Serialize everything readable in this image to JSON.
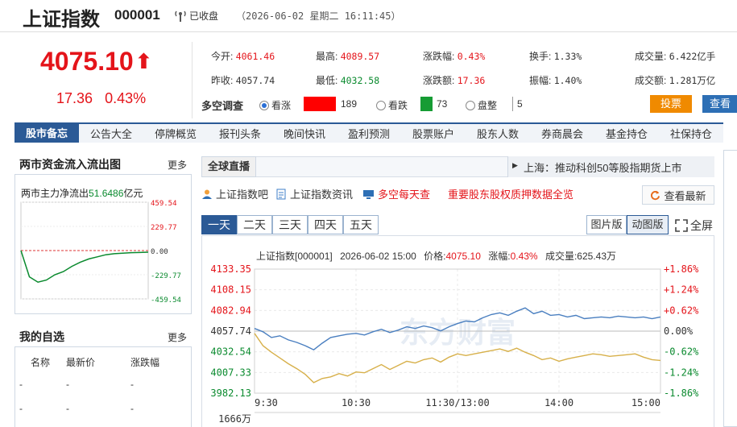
{
  "header": {
    "name": "上证指数",
    "code": "000001",
    "status": "已收盘",
    "time": "（2026-06-02 星期二 16:11:45）"
  },
  "quote": {
    "price": "4075.10",
    "arrow": "⬆",
    "change": "17.36",
    "change_pct": "0.43%"
  },
  "stats": {
    "open_label": "今开:",
    "open": "4061.46",
    "high_label": "最高:",
    "high": "4089.57",
    "pct_label": "涨跌幅:",
    "pct": "0.43%",
    "turnover_label": "换手:",
    "turnover": "1.33%",
    "vol_label": "成交量:",
    "vol": "6.422亿手",
    "prev_label": "昨收:",
    "prev": "4057.74",
    "low_label": "最低:",
    "low": "4032.58",
    "amt_label": "涨跌额:",
    "amt": "17.36",
    "amp_label": "振幅:",
    "amp": "1.40%",
    "value_label": "成交额:",
    "value": "1.281万亿"
  },
  "poll": {
    "title": "多空调查",
    "bull_label": "看涨",
    "bull_count": "189",
    "bear_label": "看跌",
    "bear_count": "73",
    "flat_label": "盘整",
    "flat_count": "5",
    "vote_button": "投票",
    "view_button": "查看",
    "colors": {
      "bull": "#ff0000",
      "bear": "#169c34"
    }
  },
  "nav": {
    "first": "股市备忘",
    "items": [
      "公告大全",
      "停牌概览",
      "报刊头条",
      "晚间快讯",
      "盈利预测",
      "股票账户",
      "股东人数",
      "券商晨会",
      "基金持仓",
      "社保持仓"
    ]
  },
  "flow_panel": {
    "title": "两市资金流入流出图",
    "more": "更多",
    "net_label": "两市主力净流出",
    "net_value": "51.6486",
    "net_unit": "亿元",
    "ticks": [
      "459.54",
      "229.77",
      "0.00",
      "-229.77",
      "-459.54"
    ],
    "values": [
      0,
      -250,
      -300,
      -280,
      -230,
      -200,
      -150,
      -110,
      -80,
      -60,
      -40,
      -30,
      -25,
      -20,
      -18,
      -15
    ]
  },
  "watch_panel": {
    "title": "我的自选",
    "more": "更多",
    "headers": [
      "名称",
      "最新价",
      "涨跌幅"
    ],
    "rows": [
      [
        "-",
        "-",
        "-"
      ],
      [
        "-",
        "-",
        "-"
      ]
    ]
  },
  "live": {
    "label": "全球直播",
    "headline": "上海：推动科创50等股指期货上市"
  },
  "links": {
    "bar": "上证指数吧",
    "news": "上证指数资讯",
    "daily": "多空每天查",
    "pledge": "重要股东股权质押数据全览",
    "latest": "查看最新"
  },
  "chart_tabs": [
    "一天",
    "二天",
    "三天",
    "四天",
    "五天"
  ],
  "chart_views": {
    "image": "图片版",
    "dynamic": "动图版",
    "fullscreen": "全屏"
  },
  "chart_data": {
    "type": "line",
    "info": {
      "name": "上证指数[000001]",
      "datetime": "2026-06-02 15:00",
      "price_label": "价格:",
      "price": "4075.10",
      "pct_label": "涨幅:",
      "pct": "0.43%",
      "vol_label": "成交量:",
      "vol": "625.43万"
    },
    "watermark": "东方财富",
    "ylim": [
      3982.13,
      4133.35
    ],
    "y_ticks_left": [
      "4133.35",
      "4108.15",
      "4082.94",
      "4057.74",
      "4032.54",
      "4007.33",
      "3982.13"
    ],
    "y_ticks_right": [
      "+1.86%",
      "+1.24%",
      "+0.62%",
      "0.00%",
      "-0.62%",
      "-1.24%",
      "-1.86%"
    ],
    "x_ticks": [
      "9:30",
      "10:30",
      "11:30/13:00",
      "14:00",
      "15:00"
    ],
    "volume_tick": "1666万",
    "series": [
      {
        "color": "#4a7fc0",
        "values": [
          4061,
          4057,
          4050,
          4052,
          4047,
          4044,
          4040,
          4035,
          4043,
          4050,
          4052,
          4054,
          4055,
          4053,
          4057,
          4060,
          4056,
          4059,
          4063,
          4061,
          4064,
          4062,
          4058,
          4063,
          4067,
          4070,
          4069,
          4074,
          4078,
          4080,
          4077,
          4082,
          4086,
          4079,
          4082,
          4077,
          4078,
          4075,
          4077,
          4073,
          4074,
          4075,
          4074,
          4076,
          4075,
          4074,
          4075,
          4073,
          4075
        ]
      },
      {
        "color": "#d7b04a",
        "values": [
          4055,
          4040,
          4032,
          4025,
          4018,
          4012,
          4005,
          3995,
          4000,
          4002,
          4006,
          4003,
          4008,
          4007,
          4012,
          4017,
          4011,
          4016,
          4021,
          4019,
          4023,
          4025,
          4020,
          4026,
          4030,
          4028,
          4030,
          4032,
          4034,
          4036,
          4033,
          4037,
          4032,
          4028,
          4023,
          4025,
          4021,
          4024,
          4026,
          4028,
          4030,
          4029,
          4027,
          4028,
          4029,
          4030,
          4026,
          4023,
          4022
        ]
      }
    ]
  }
}
